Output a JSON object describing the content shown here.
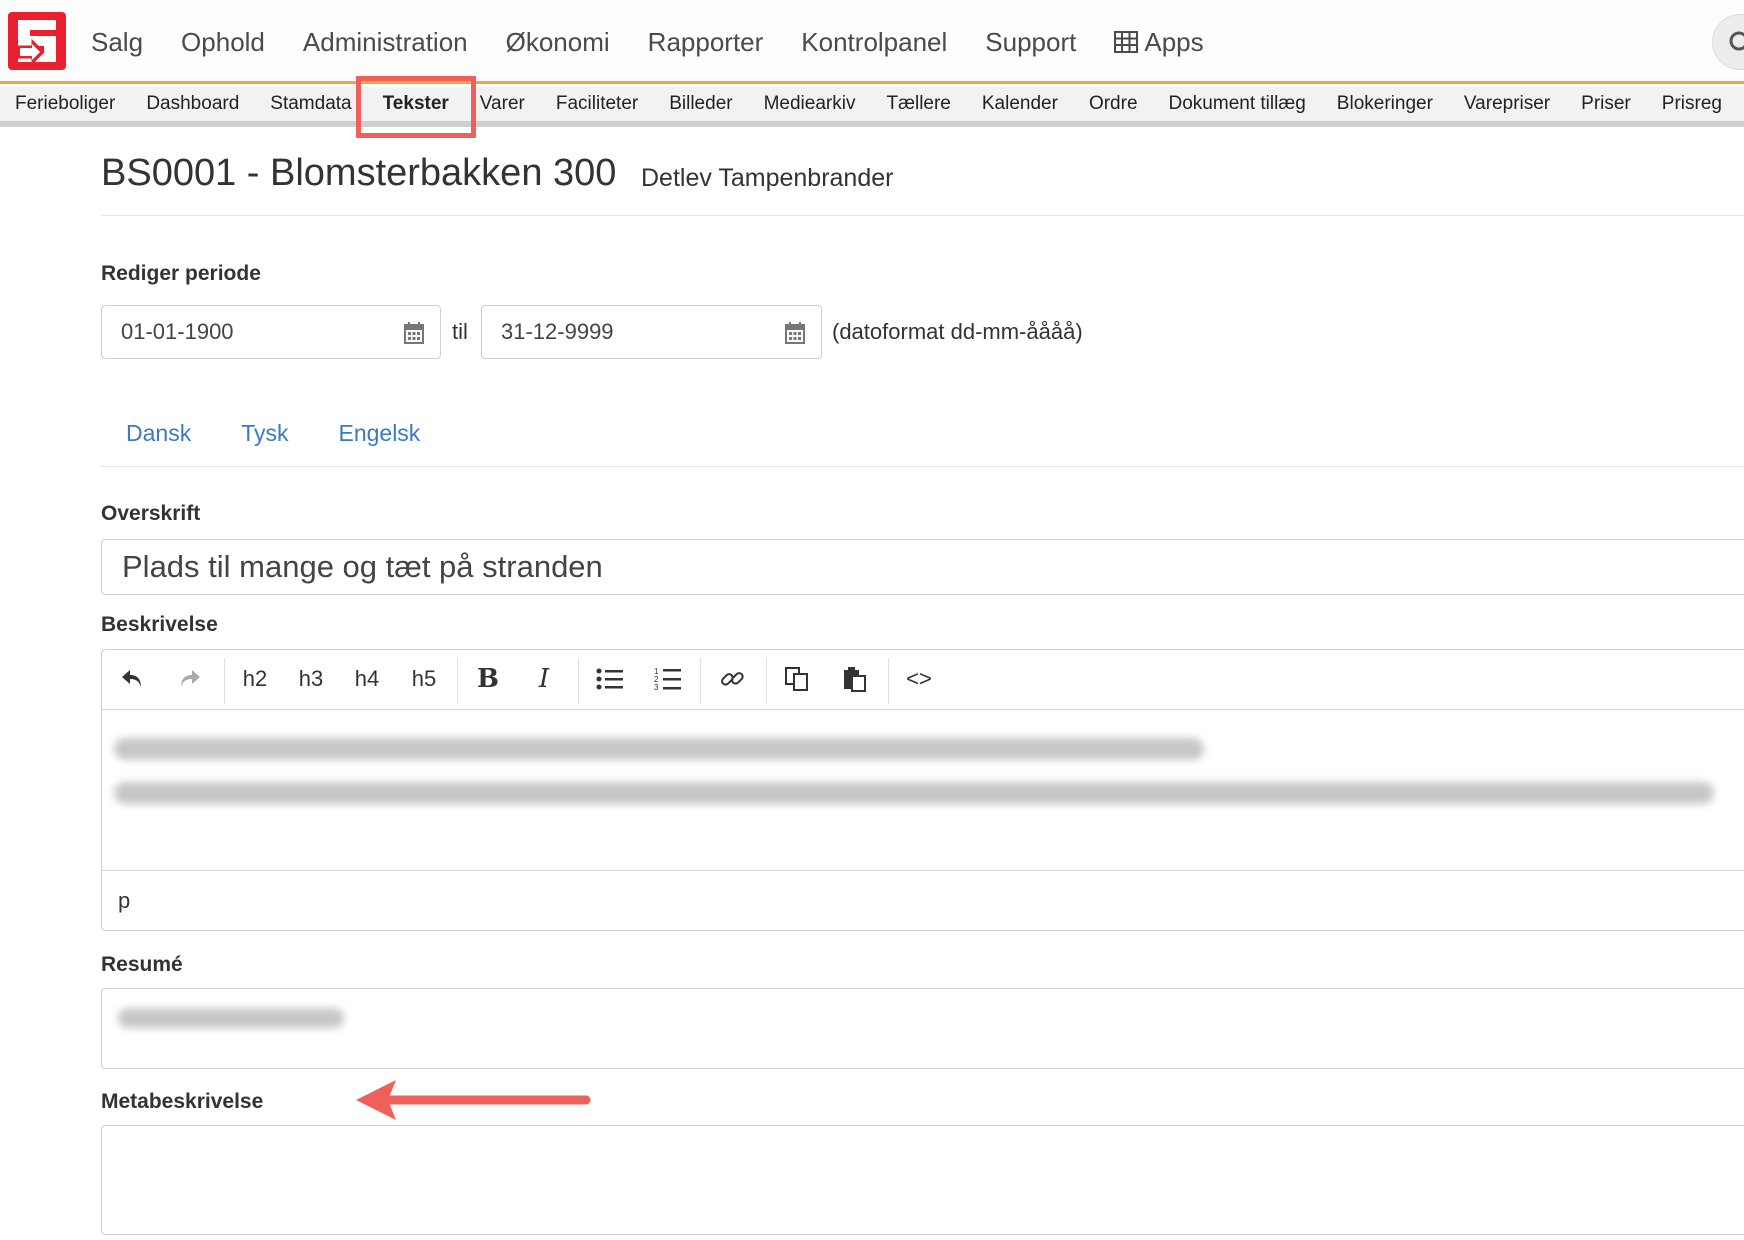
{
  "topnav": {
    "items": [
      "Salg",
      "Ophold",
      "Administration",
      "Økonomi",
      "Rapporter",
      "Kontrolpanel",
      "Support",
      "Apps"
    ],
    "accent_color": "#f0a540",
    "logo_color": "#e8202f"
  },
  "subnav": {
    "tabs": [
      "Ferieboliger",
      "Dashboard",
      "Stamdata",
      "Tekster",
      "Varer",
      "Faciliteter",
      "Billeder",
      "Mediearkiv",
      "Tællere",
      "Kalender",
      "Ordre",
      "Dokument tillæg",
      "Blokeringer",
      "Varepriser",
      "Priser",
      "Prisreg"
    ],
    "active": "Tekster"
  },
  "header": {
    "title": "BS0001 - Blomsterbakken 300",
    "subtitle": "Detlev Tampenbrander"
  },
  "period": {
    "label": "Rediger periode",
    "from": "01-01-1900",
    "separator": "til",
    "to": "31-12-9999",
    "format_hint": "(datoformat dd-mm-åååå)"
  },
  "languages": [
    "Dansk",
    "Tysk",
    "Engelsk"
  ],
  "fields": {
    "overskrift_label": "Overskrift",
    "overskrift_value": "Plads til mange og tæt på stranden",
    "beskrivelse_label": "Beskrivelse",
    "editor_status": "p",
    "resume_label": "Resumé",
    "meta_label": "Metabeskrivelse"
  },
  "editor_toolbar": {
    "h2": "h2",
    "h3": "h3",
    "h4": "h4",
    "h5": "h5",
    "bold": "B",
    "italic": "I",
    "code": "<>"
  },
  "annotation_color": "#f0605a"
}
